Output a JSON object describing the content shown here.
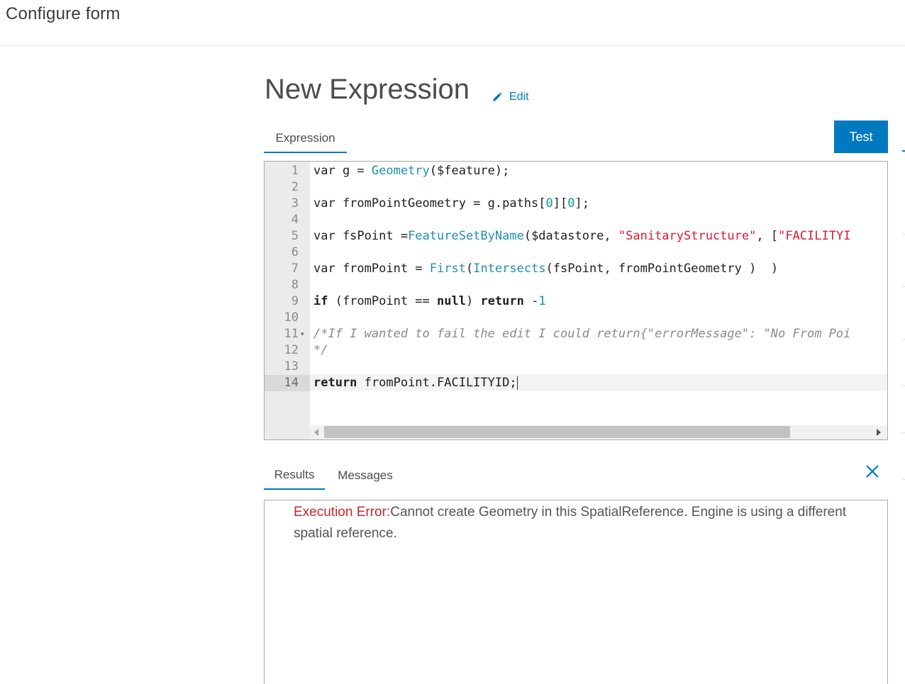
{
  "app": {
    "title": "Configure form"
  },
  "expression": {
    "title": "New Expression",
    "edit_label": "Edit",
    "tab_label": "Expression",
    "test_label": "Test"
  },
  "editor": {
    "current_line": 14,
    "line_numbers": [
      "1",
      "2",
      "3",
      "4",
      "5",
      "6",
      "7",
      "8",
      "9",
      "10",
      "11",
      "12",
      "13",
      "14"
    ],
    "lines": [
      {
        "segments": [
          {
            "t": "var g = ",
            "c": ""
          },
          {
            "t": "Geometry",
            "c": "fn"
          },
          {
            "t": "($feature);",
            "c": ""
          }
        ]
      },
      {
        "segments": []
      },
      {
        "segments": [
          {
            "t": "var fromPointGeometry = g.paths[",
            "c": ""
          },
          {
            "t": "0",
            "c": "num"
          },
          {
            "t": "][",
            "c": ""
          },
          {
            "t": "0",
            "c": "num"
          },
          {
            "t": "];",
            "c": ""
          }
        ]
      },
      {
        "segments": []
      },
      {
        "segments": [
          {
            "t": "var fsPoint =",
            "c": ""
          },
          {
            "t": "FeatureSetByName",
            "c": "fn"
          },
          {
            "t": "($datastore, ",
            "c": ""
          },
          {
            "t": "\"SanitaryStructure\"",
            "c": "str"
          },
          {
            "t": ", [",
            "c": ""
          },
          {
            "t": "\"FACILITYI",
            "c": "str"
          }
        ]
      },
      {
        "segments": []
      },
      {
        "segments": [
          {
            "t": "var fromPoint = ",
            "c": ""
          },
          {
            "t": "First",
            "c": "fn"
          },
          {
            "t": "(",
            "c": ""
          },
          {
            "t": "Intersects",
            "c": "fn"
          },
          {
            "t": "(fsPoint, fromPointGeometry )  )",
            "c": ""
          }
        ]
      },
      {
        "segments": []
      },
      {
        "segments": [
          {
            "t": "if",
            "c": "kw"
          },
          {
            "t": " (fromPoint == ",
            "c": ""
          },
          {
            "t": "null",
            "c": "kw"
          },
          {
            "t": ") ",
            "c": ""
          },
          {
            "t": "return",
            "c": "kw"
          },
          {
            "t": " -",
            "c": ""
          },
          {
            "t": "1",
            "c": "num"
          }
        ]
      },
      {
        "segments": []
      },
      {
        "segments": [
          {
            "t": "/*If I wanted to fail the edit I could return{\"errorMessage\": \"No From Poi",
            "c": "cmt"
          }
        ]
      },
      {
        "segments": [
          {
            "t": "*/",
            "c": "cmt"
          }
        ]
      },
      {
        "segments": []
      },
      {
        "segments": [
          {
            "t": "return",
            "c": "kw"
          },
          {
            "t": " fromPoint.FACILITYID;",
            "c": ""
          }
        ]
      }
    ],
    "fold_marker_line": 11,
    "scroll_position": 0.0
  },
  "results": {
    "tabs": {
      "results_label": "Results",
      "messages_label": "Messages"
    },
    "active_tab": "Results",
    "error_label": "Execution Error:",
    "error_message": "Cannot create Geometry in this SpatialReference. Engine is using a different spatial reference."
  },
  "colors": {
    "accent": "#0079c1",
    "error": "#c6262e",
    "function": "#1f8fb0",
    "string": "#d81b39",
    "number": "#0b9b8e",
    "comment": "#8a8a8a"
  },
  "icons": {
    "edit": "pencil-icon",
    "close": "close-icon",
    "fold": "chevron-down-icon"
  }
}
